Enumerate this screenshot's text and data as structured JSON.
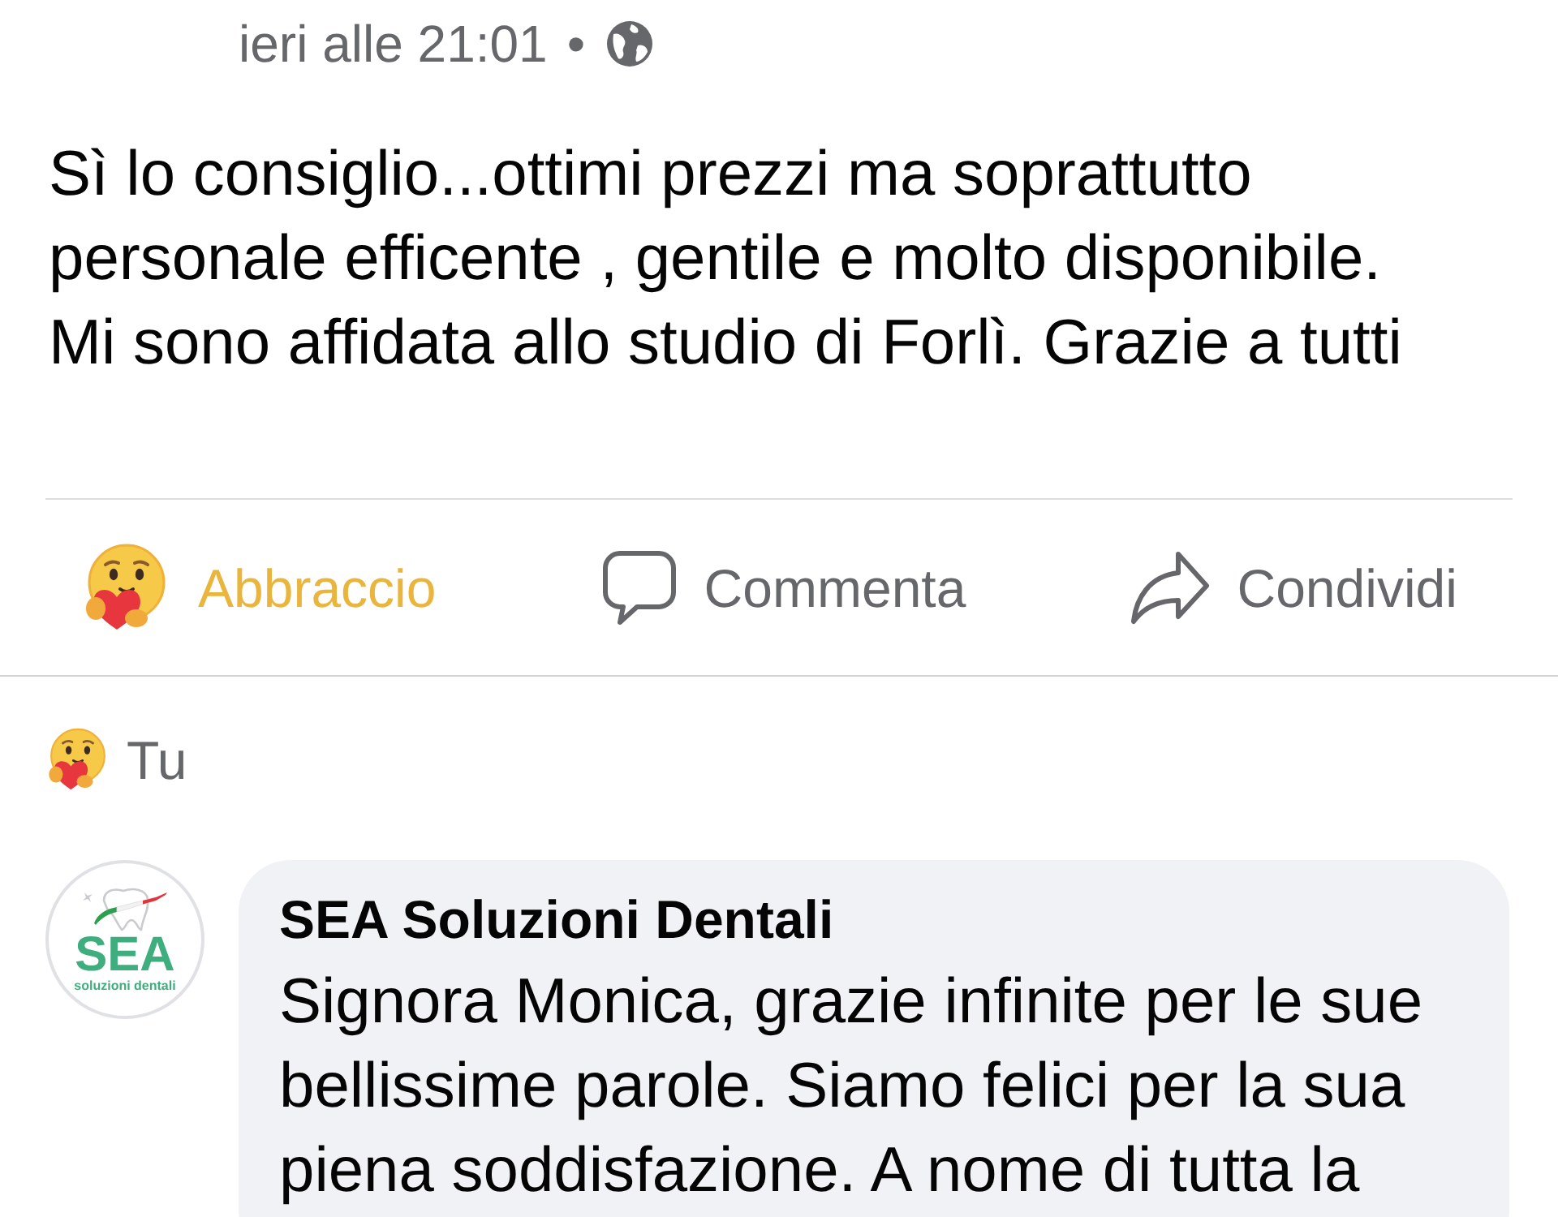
{
  "post": {
    "timestamp": "ieri alle 21:01",
    "separator": "•",
    "text": "Sì lo consiglio...ottimi prezzi ma soprattutto personale efficente , gentile e molto disponibile. Mi sono affidata allo studio di Forlì. Grazie a tutti"
  },
  "actions": [
    {
      "kind": "reaction",
      "label": "Abbraccio",
      "active": true
    },
    {
      "kind": "comment",
      "label": "Commenta",
      "active": false
    },
    {
      "kind": "share",
      "label": "Condividi",
      "active": false
    }
  ],
  "reactions_summary": {
    "label": "Tu"
  },
  "comment": {
    "author": "SEA Soluzioni Dentali",
    "logo": {
      "title": "SEA",
      "subtitle": "soluzioni dentali"
    },
    "text": "Signora Monica, grazie infinite per le sue bellissime parole. Siamo felici per la sua piena soddisfazione. A nome di tutta la"
  }
}
